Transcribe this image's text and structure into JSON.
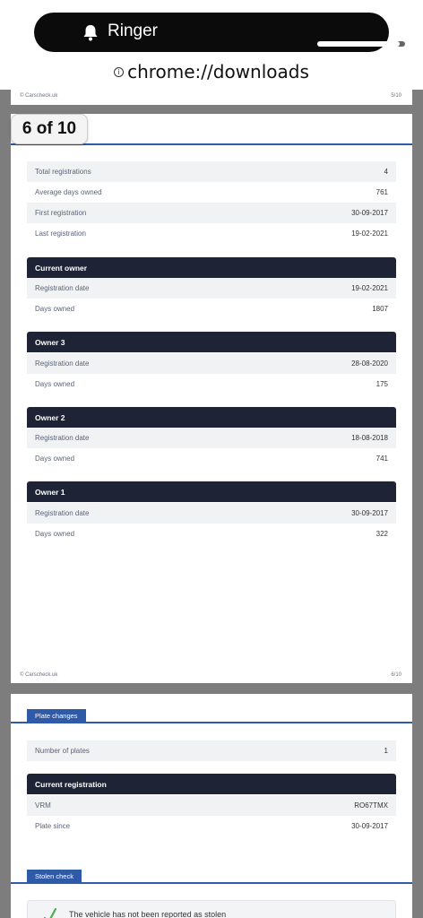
{
  "status_pill": {
    "label": "Ringer"
  },
  "address_bar": {
    "url": "chrome://downloads",
    "info_icon": "i"
  },
  "page5": {
    "footer_left": "© Carscheck.uk",
    "footer_right": "5/10"
  },
  "page6": {
    "page_badge": "6 of 10",
    "summary": [
      {
        "label": "Total registrations",
        "value": "4"
      },
      {
        "label": "Average days owned",
        "value": "761"
      },
      {
        "label": "First registration",
        "value": "30-09-2017"
      },
      {
        "label": "Last registration",
        "value": "19-02-2021"
      }
    ],
    "owners": [
      {
        "title": "Current owner",
        "rows": [
          {
            "label": "Registration date",
            "value": "19-02-2021"
          },
          {
            "label": "Days owned",
            "value": "1807"
          }
        ]
      },
      {
        "title": "Owner 3",
        "rows": [
          {
            "label": "Registration date",
            "value": "28-08-2020"
          },
          {
            "label": "Days owned",
            "value": "175"
          }
        ]
      },
      {
        "title": "Owner 2",
        "rows": [
          {
            "label": "Registration date",
            "value": "18-08-2018"
          },
          {
            "label": "Days owned",
            "value": "741"
          }
        ]
      },
      {
        "title": "Owner 1",
        "rows": [
          {
            "label": "Registration date",
            "value": "30-09-2017"
          },
          {
            "label": "Days owned",
            "value": "322"
          }
        ]
      }
    ],
    "footer_left": "© Carscheck.uk",
    "footer_right": "6/10"
  },
  "page7": {
    "plate_tab": "Plate changes",
    "plates_row": {
      "label": "Number of plates",
      "value": "1"
    },
    "current_reg_title": "Current registration",
    "current_reg_rows": [
      {
        "label": "VRM",
        "value": "RO67TMX"
      },
      {
        "label": "Plate since",
        "value": "30-09-2017"
      }
    ],
    "stolen_tab": "Stolen check",
    "stolen_text": "The vehicle has not been reported as stolen"
  },
  "colors": {
    "accent_blue": "#2f5aa8",
    "header_navy": "#1e2436",
    "viewer_gray": "#7d7d7d",
    "check_green": "#4caf50"
  }
}
